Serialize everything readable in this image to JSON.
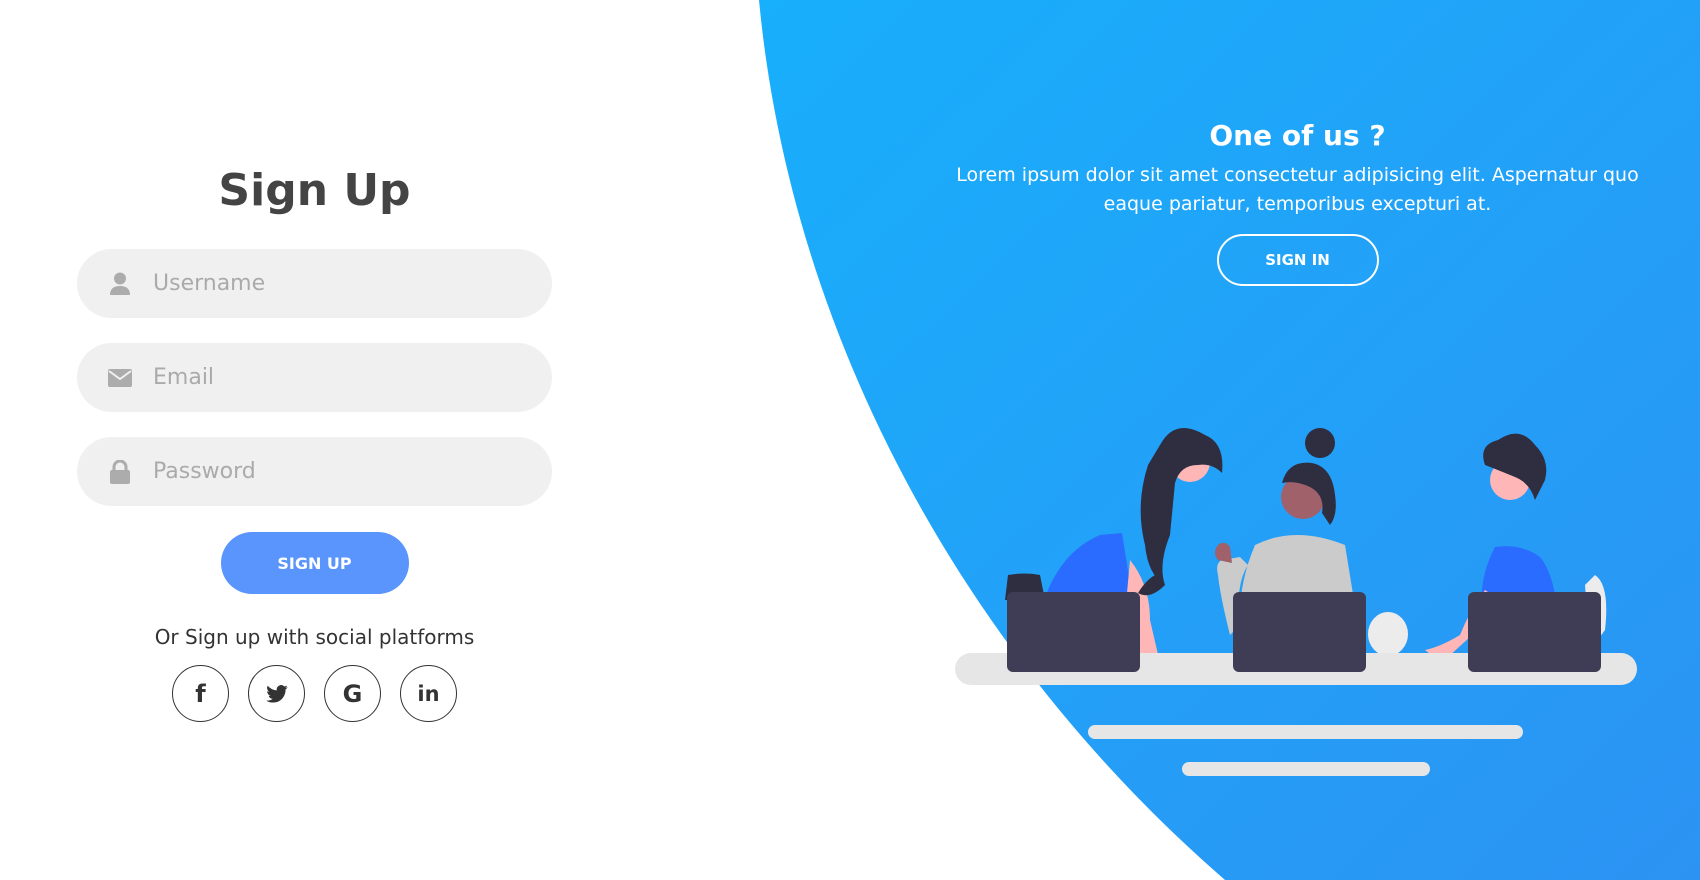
{
  "signup": {
    "title": "Sign Up",
    "username_placeholder": "Username",
    "email_placeholder": "Email",
    "password_placeholder": "Password",
    "submit_label": "SIGN UP",
    "social_text": "Or Sign up with social platforms",
    "social": [
      {
        "name": "facebook-icon",
        "label": "f"
      },
      {
        "name": "twitter-icon",
        "label": ""
      },
      {
        "name": "google-icon",
        "label": "G"
      },
      {
        "name": "linkedin-icon",
        "label": "in"
      }
    ]
  },
  "panel": {
    "heading": "One of us ?",
    "text": "Lorem ipsum dolor sit amet consectetur adipisicing elit. Aspernatur quo eaque pariatur, temporibus excepturi at.",
    "button_label": "SIGN IN"
  },
  "colors": {
    "primary": "#5995fd",
    "gradient_start": "#1aaefc",
    "gradient_end": "#2d96f4",
    "input_bg": "#f0f0f0"
  }
}
